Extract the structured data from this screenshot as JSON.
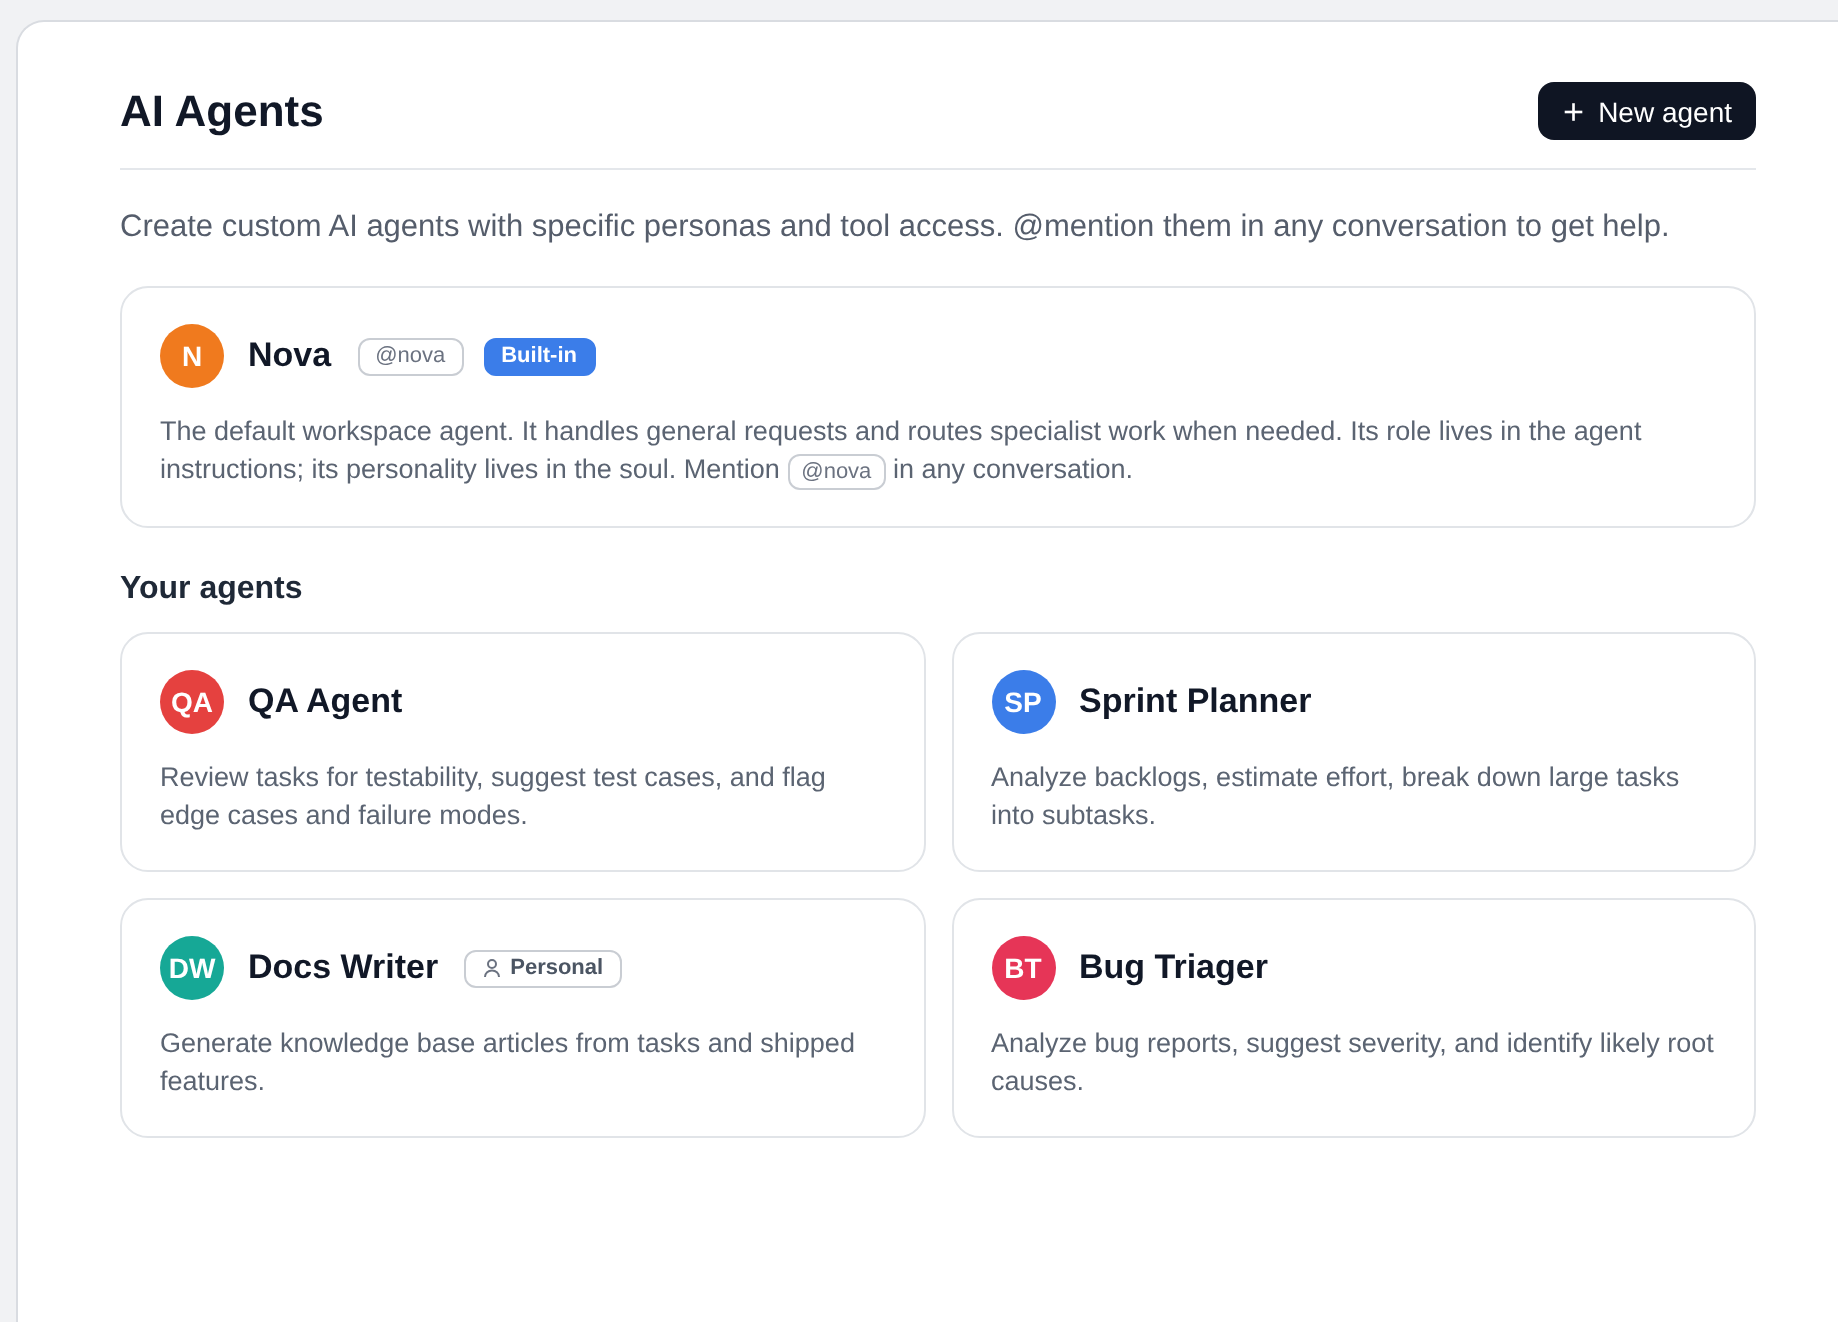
{
  "header": {
    "title": "AI Agents",
    "new_button": {
      "icon": "+",
      "label": "New agent"
    }
  },
  "intro": "Create custom AI agents with specific personas and tool access. @mention them in any conversation to get help.",
  "builtin_agent": {
    "initials": "N",
    "color": "#f07a1e",
    "name": "Nova",
    "badges": [
      {
        "kind": "handle",
        "label": "@nova"
      },
      {
        "kind": "builtin",
        "label": "Built-in"
      }
    ],
    "description": [
      {
        "kind": "text",
        "text": "The default workspace agent. It handles general requests and routes specialist work when needed. Its role lives in the agent instructions; its personality lives in the soul. Mention "
      },
      {
        "kind": "mention",
        "text": "@nova"
      },
      {
        "kind": "text",
        "text": " in any conversation."
      }
    ]
  },
  "section_title": "Your agents",
  "agents": [
    {
      "initials": "QA",
      "color": "#e5413f",
      "name": "QA Agent",
      "description": "Review tasks for testability, suggest test cases, and flag edge cases and failure modes."
    },
    {
      "initials": "SP",
      "color": "#3b7de9",
      "name": "Sprint Planner",
      "description": "Analyze backlogs, estimate effort, break down large tasks into subtasks."
    },
    {
      "initials": "DW",
      "color": "#16a896",
      "name": "Docs Writer",
      "badges": [
        {
          "kind": "personal",
          "label": "Personal"
        }
      ],
      "description": "Generate knowledge base articles from tasks and shipped features."
    },
    {
      "initials": "BT",
      "color": "#e63557",
      "name": "Bug Triager",
      "description": "Analyze bug reports, suggest severity, and identify likely root causes."
    }
  ]
}
